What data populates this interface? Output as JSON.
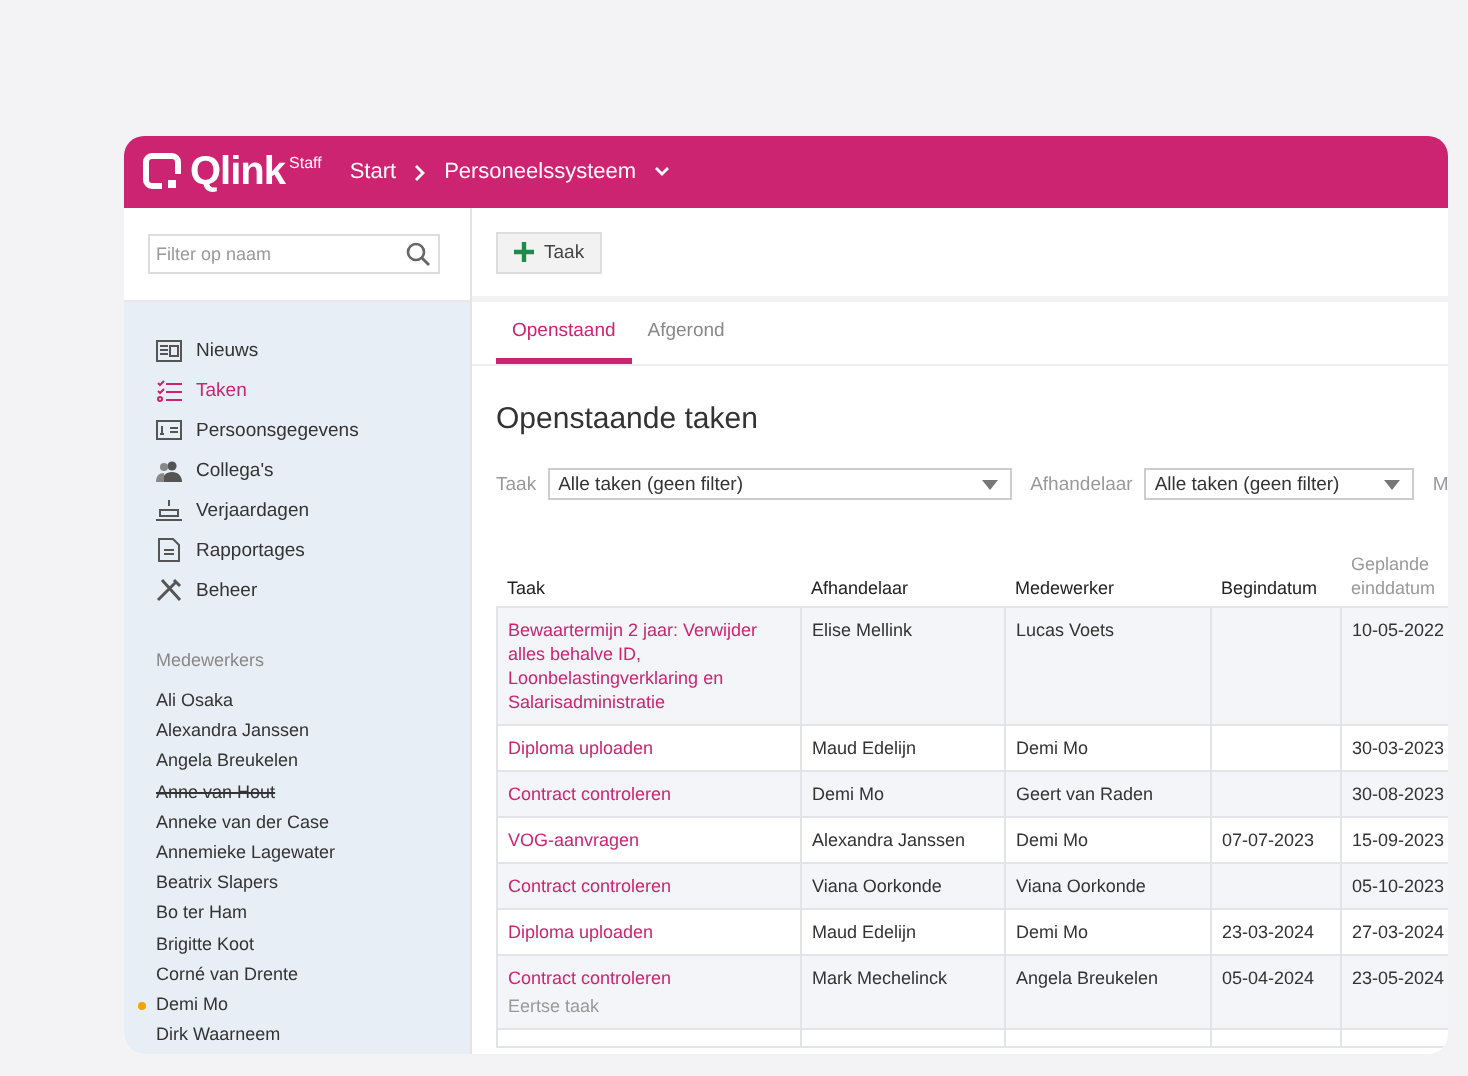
{
  "header": {
    "logo": "Qlink",
    "logo_badge": "Staff",
    "breadcrumb": [
      "Start",
      "Personeelssysteem"
    ]
  },
  "sidebar": {
    "search": {
      "placeholder": "Filter op naam"
    },
    "menu": [
      {
        "label": "Nieuws",
        "kind": "news",
        "selected": false
      },
      {
        "label": "Taken",
        "kind": "tasks",
        "selected": true
      },
      {
        "label": "Persoonsgegevens",
        "kind": "card",
        "selected": false
      },
      {
        "label": "Collega's",
        "kind": "people",
        "selected": false
      },
      {
        "label": "Verjaardagen",
        "kind": "cake",
        "selected": false
      },
      {
        "label": "Rapportages",
        "kind": "report",
        "selected": false
      },
      {
        "label": "Beheer",
        "kind": "tools",
        "selected": false
      }
    ],
    "employees_heading": "Medewerkers",
    "employees": [
      {
        "name": "Ali Osaka",
        "online": false,
        "struck": false
      },
      {
        "name": "Alexandra Janssen",
        "online": false,
        "struck": false
      },
      {
        "name": "Angela Breukelen",
        "online": false,
        "struck": false
      },
      {
        "name": "Anne van Hout",
        "online": false,
        "struck": true
      },
      {
        "name": "Anneke van der Case",
        "online": false,
        "struck": false
      },
      {
        "name": "Annemieke Lagewater",
        "online": false,
        "struck": false
      },
      {
        "name": "Beatrix Slapers",
        "online": false,
        "struck": false
      },
      {
        "name": "Bo ter Ham",
        "online": false,
        "struck": false
      },
      {
        "name": "Brigitte Koot",
        "online": false,
        "struck": false
      },
      {
        "name": "Corné van Drente",
        "online": false,
        "struck": false
      },
      {
        "name": "Demi Mo",
        "online": true,
        "struck": false
      },
      {
        "name": "Dirk Waarneem",
        "online": false,
        "struck": false
      }
    ]
  },
  "toolbar": {
    "add_button": "Taak"
  },
  "tabs": [
    {
      "label": "Openstaand",
      "selected": true
    },
    {
      "label": "Afgerond",
      "selected": false
    }
  ],
  "title": "Openstaande taken",
  "filters": [
    {
      "label": "Taak",
      "value": "Alle taken (geen filter)"
    },
    {
      "label": "Afhandelaar",
      "value": "Alle taken (geen filter)"
    },
    {
      "label": "M"
    }
  ],
  "table": {
    "columns": [
      "Taak",
      "Afhandelaar",
      "Medewerker",
      "Begindatum",
      "Geplande einddatum"
    ],
    "rows": [
      {
        "task": "Bewaartermijn 2 jaar: Verwijder alles behalve ID, Loonbelastingverklaring en Salarisadministratie",
        "handler": "Elise Mellink",
        "employee": "Lucas Voets",
        "start": "",
        "end": "10-05-2022"
      },
      {
        "task": "Diploma uploaden",
        "handler": "Maud Edelijn",
        "employee": "Demi Mo",
        "start": "",
        "end": "30-03-2023"
      },
      {
        "task": "Contract controleren",
        "handler": "Demi Mo",
        "employee": "Geert van Raden",
        "start": "",
        "end": "30-08-2023"
      },
      {
        "task": "VOG-aanvragen",
        "handler": "Alexandra Janssen",
        "employee": "Demi Mo",
        "start": "07-07-2023",
        "end": "15-09-2023"
      },
      {
        "task": "Contract controleren",
        "handler": "Viana Oorkonde",
        "employee": "Viana Oorkonde",
        "start": "",
        "end": "05-10-2023"
      },
      {
        "task": "Diploma uploaden",
        "handler": "Maud Edelijn",
        "employee": "Demi Mo",
        "start": "23-03-2024",
        "end": "27-03-2024"
      },
      {
        "task": "Contract controleren",
        "note": "Eertse taak",
        "handler": "Mark Mechelinck",
        "employee": "Angela Breukelen",
        "start": "05-04-2024",
        "end": "23-05-2024"
      }
    ]
  }
}
